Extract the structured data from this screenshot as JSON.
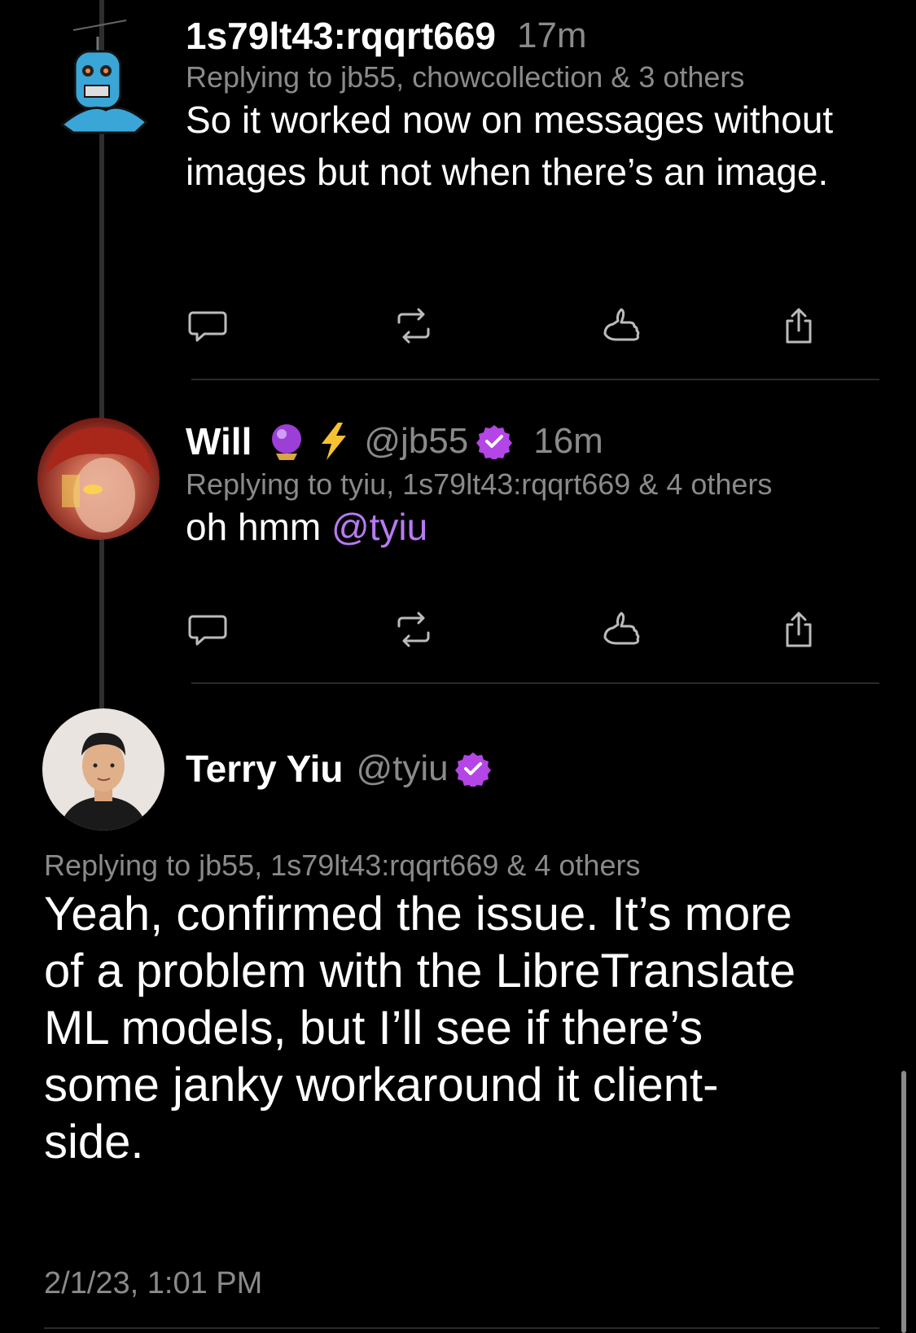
{
  "posts": [
    {
      "display_name": "1s79lt43:rqqrt669",
      "time": "17m",
      "replying_to": "Replying to jb55, chowcollection & 3 others",
      "text": "So it worked now on messages without images but not when there’s an image.",
      "avatar_icon": "robot-avatar"
    },
    {
      "display_name": "Will",
      "name_emojis": "🔮 ⚡",
      "handle": "@jb55",
      "time": "16m",
      "replying_to": "Replying to tyiu, 1s79lt43:rqqrt669 & 4 others",
      "text_prefix": "oh hmm ",
      "mention": "@tyiu",
      "verified": true
    },
    {
      "display_name": "Terry Yiu",
      "handle": "@tyiu",
      "verified": true,
      "replying_to": "Replying to jb55, 1s79lt43:rqqrt669 & 4 others",
      "text_lines": [
        "Yeah, confirmed the issue. It’s more",
        "of a problem with the LibreTranslate",
        "ML models, but I’ll see if there’s",
        "some janky workaround it client-",
        "side."
      ],
      "timestamp": "2/1/23, 1:01 PM"
    }
  ],
  "action_icons": [
    "comment-icon",
    "repost-icon",
    "shaka-icon",
    "share-icon"
  ],
  "colors": {
    "background": "#000000",
    "muted": "#8a8a8a",
    "accent": "#b77af0",
    "verified": "#b445e6"
  }
}
